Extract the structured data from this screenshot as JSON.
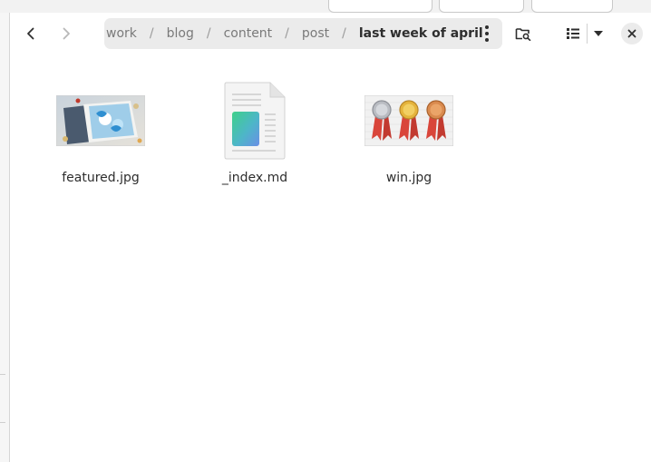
{
  "navigation": {
    "back_label": "Back",
    "forward_label": "Forward"
  },
  "pathbar": {
    "crumbs": [
      "work",
      "blog",
      "content",
      "post",
      "last week of april"
    ],
    "separator": "/"
  },
  "files": [
    {
      "name": "featured.jpg",
      "kind": "image",
      "icon": "photo-thumbnail-icon"
    },
    {
      "name": "_index.md",
      "kind": "text",
      "icon": "document-icon"
    },
    {
      "name": "win.jpg",
      "kind": "image",
      "icon": "medals-thumbnail-icon"
    }
  ],
  "colors": {
    "accent_text": "#2e2e2e",
    "muted_text": "#7a7a7a",
    "pathbar_bg": "#ebebeb",
    "window_bg": "#ffffff"
  }
}
